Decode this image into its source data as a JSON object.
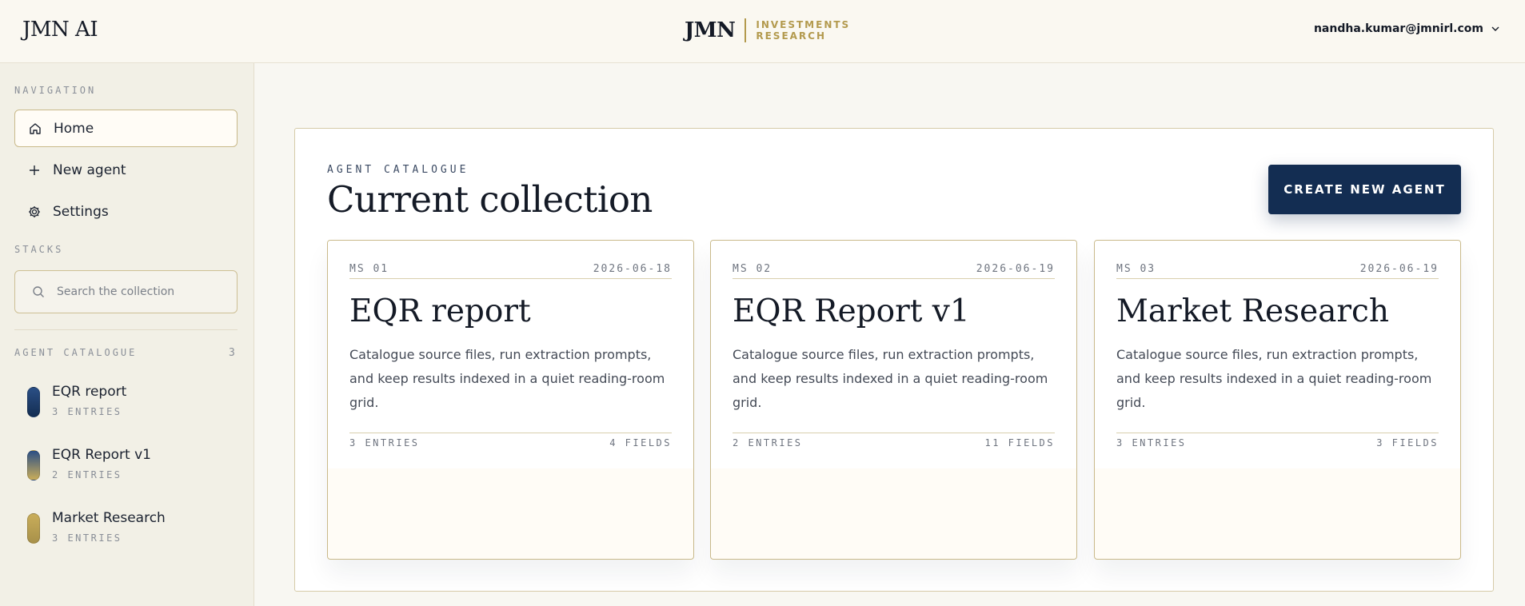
{
  "header": {
    "app_title": "JMN AI",
    "brand_name": "JMN",
    "brand_line1": "INVESTMENTS",
    "brand_line2": "RESEARCH",
    "user_email": "nandha.kumar@jmnirl.com"
  },
  "sidebar": {
    "nav_label": "NAVIGATION",
    "nav_items": [
      {
        "label": "Home",
        "icon": "home-icon",
        "active": true
      },
      {
        "label": "New agent",
        "icon": "plus-icon",
        "active": false
      },
      {
        "label": "Settings",
        "icon": "gear-icon",
        "active": false
      }
    ],
    "stacks_label": "STACKS",
    "search_placeholder": "Search the collection",
    "catalogue_label": "AGENT CATALOGUE",
    "catalogue_count": "3",
    "catalogue_items": [
      {
        "name": "EQR report",
        "entries": "3 ENTRIES",
        "color": "#1d3f6e"
      },
      {
        "name": "EQR Report v1",
        "entries": "2 ENTRIES",
        "color": "#6b7a5f"
      },
      {
        "name": "Market Research",
        "entries": "3 ENTRIES",
        "color": "#b39a4e"
      }
    ]
  },
  "main": {
    "kicker": "AGENT CATALOGUE",
    "title": "Current collection",
    "create_button": "CREATE NEW AGENT",
    "cards": [
      {
        "num": "MS 01",
        "date": "2026-06-18",
        "title": "EQR report",
        "description": "Catalogue source files, run extraction prompts, and keep results indexed in a quiet reading-room grid.",
        "entries": "3 ENTRIES",
        "fields": "4 FIELDS"
      },
      {
        "num": "MS 02",
        "date": "2026-06-19",
        "title": "EQR Report v1",
        "description": "Catalogue source files, run extraction prompts, and keep results indexed in a quiet reading-room grid.",
        "entries": "2 ENTRIES",
        "fields": "11 FIELDS"
      },
      {
        "num": "MS 03",
        "date": "2026-06-19",
        "title": "Market Research",
        "description": "Catalogue source files, run extraction prompts, and keep results indexed in a quiet reading-room grid.",
        "entries": "3 ENTRIES",
        "fields": "3 FIELDS"
      }
    ]
  },
  "colors": {
    "accent_navy": "#132d52",
    "accent_gold": "#b39a4e"
  }
}
